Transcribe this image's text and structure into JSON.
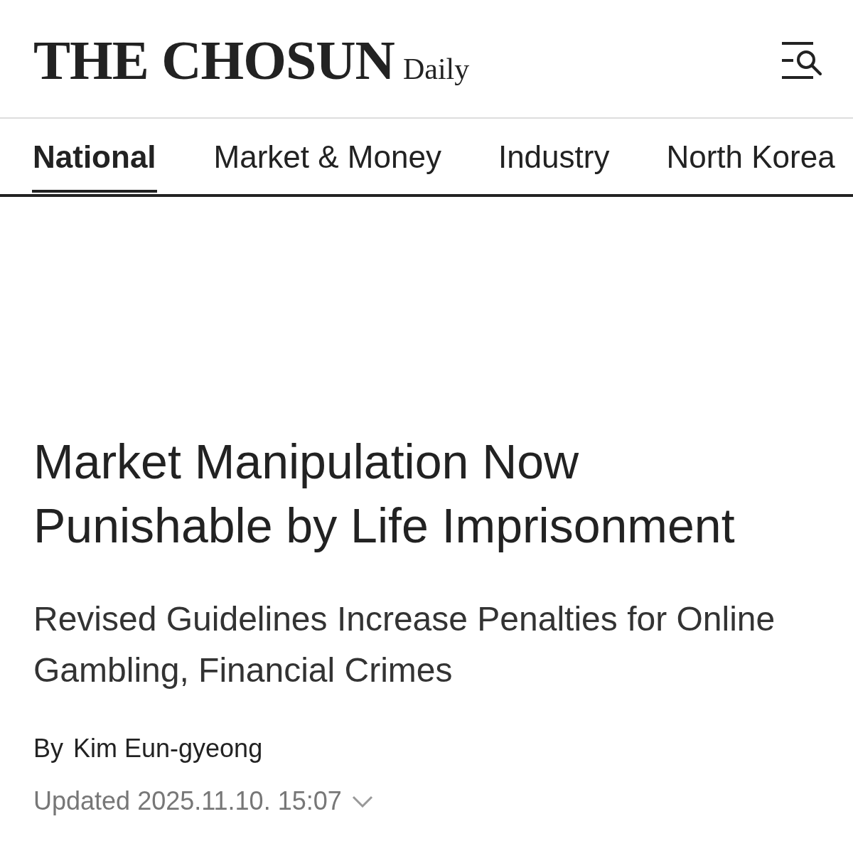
{
  "header": {
    "logo": {
      "name": "THE CHOSUN",
      "suffix": "Daily"
    }
  },
  "tabs": [
    {
      "label": "National",
      "selected": true
    },
    {
      "label": "Market & Money",
      "selected": false
    },
    {
      "label": "Industry",
      "selected": false
    },
    {
      "label": "North Korea",
      "selected": false
    }
  ],
  "article": {
    "headline": "Market Manipulation Now Punishable by Life Imprisonment",
    "subheadline": "Revised Guidelines Increase Penalties for Online Gambling, Financial Crimes",
    "byline": {
      "prefix": "By",
      "author": "Kim Eun-gyeong"
    },
    "updated": {
      "label": "Updated",
      "date": "2025.11.10. 15:07",
      "expanded": false
    }
  }
}
